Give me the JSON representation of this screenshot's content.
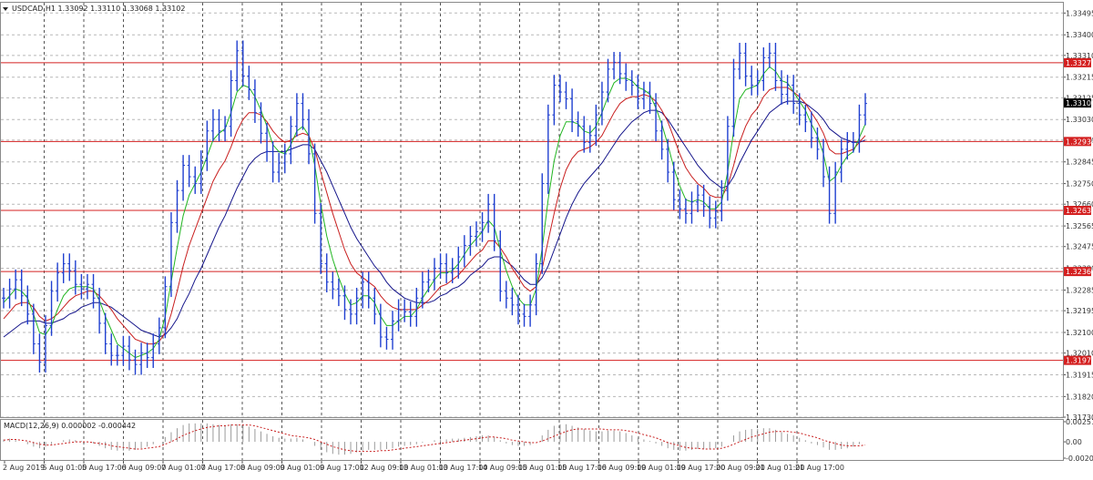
{
  "chart_data": {
    "type": "line",
    "symbol": "USDCAD,H1",
    "ohlc_header": "USDCAD,H1  1.33092 1.33110 1.33068 1.33102",
    "ylim": [
      1.3173,
      1.3354
    ],
    "price_ticks": [
      "1.33495",
      "1.33400",
      "1.33310",
      "1.33215",
      "1.33125",
      "1.33030",
      "1.32940",
      "1.32845",
      "1.32750",
      "1.32660",
      "1.32565",
      "1.32475",
      "1.32380",
      "1.32285",
      "1.32195",
      "1.32100",
      "1.32010",
      "1.31915",
      "1.31820",
      "1.31730"
    ],
    "time_labels": [
      "2 Aug 2019",
      "5 Aug 01:00",
      "5 Aug 17:00",
      "6 Aug 09:00",
      "7 Aug 01:00",
      "7 Aug 17:00",
      "8 Aug 09:00",
      "9 Aug 01:00",
      "9 Aug 17:00",
      "12 Aug 09:00",
      "13 Aug 01:00",
      "13 Aug 17:00",
      "14 Aug 09:00",
      "15 Aug 01:00",
      "15 Aug 17:00",
      "16 Aug 09:00",
      "19 Aug 01:00",
      "19 Aug 17:00",
      "20 Aug 09:00",
      "21 Aug 01:00",
      "21 Aug 17:00"
    ],
    "horizontal_levels": [
      {
        "label": "1.33278",
        "value": 1.33278
      },
      {
        "label": "1.32934",
        "value": 1.32934
      },
      {
        "label": "1.32633",
        "value": 1.32633
      },
      {
        "label": "1.32366",
        "value": 1.32366
      },
      {
        "label": "1.31978",
        "value": 1.31978
      }
    ],
    "current_price": "1.33102",
    "price_bars": [
      1.3225,
      1.3229,
      1.3233,
      1.3226,
      1.3218,
      1.3205,
      1.3197,
      1.3213,
      1.3228,
      1.3236,
      1.324,
      1.3237,
      1.3231,
      1.3229,
      1.3231,
      1.3225,
      1.3214,
      1.3205,
      1.32,
      1.32,
      1.3204,
      1.3198,
      1.3196,
      1.3201,
      1.3199,
      1.3205,
      1.3212,
      1.323,
      1.3258,
      1.3272,
      1.3283,
      1.3278,
      1.3275,
      1.3285,
      1.3298,
      1.3303,
      1.3298,
      1.33,
      1.332,
      1.3333,
      1.3322,
      1.3316,
      1.3306,
      1.3297,
      1.3289,
      1.328,
      1.3284,
      1.3288,
      1.33,
      1.331,
      1.3303,
      1.3288,
      1.3262,
      1.324,
      1.3232,
      1.3229,
      1.3226,
      1.322,
      1.3218,
      1.3225,
      1.3232,
      1.3225,
      1.3218,
      1.3208,
      1.3207,
      1.3215,
      1.322,
      1.3219,
      1.3217,
      1.3225,
      1.3232,
      1.3233,
      1.3238,
      1.324,
      1.3236,
      1.3238,
      1.3243,
      1.3248,
      1.3252,
      1.3254,
      1.3258,
      1.3266,
      1.325,
      1.3228,
      1.3225,
      1.3222,
      1.3218,
      1.3217,
      1.3222,
      1.324,
      1.3275,
      1.3305,
      1.3318,
      1.3315,
      1.3312,
      1.3302,
      1.33,
      1.3293,
      1.3296,
      1.3305,
      1.3315,
      1.3325,
      1.3328,
      1.3323,
      1.332,
      1.3318,
      1.3312,
      1.3315,
      1.331,
      1.3298,
      1.329,
      1.328,
      1.3268,
      1.3264,
      1.3262,
      1.3267,
      1.327,
      1.3265,
      1.326,
      1.3263,
      1.3272,
      1.33,
      1.3325,
      1.3332,
      1.3322,
      1.3318,
      1.332,
      1.333,
      1.3332,
      1.332,
      1.3314,
      1.3318,
      1.331,
      1.3305,
      1.3302,
      1.3295,
      1.329,
      1.3278,
      1.3262,
      1.328,
      1.329,
      1.3293,
      1.3293,
      1.3305,
      1.331
    ],
    "ma_fast": [
      1.3223,
      1.3226,
      1.3229,
      1.3228,
      1.3225,
      1.3218,
      1.321,
      1.3209,
      1.3213,
      1.322,
      1.3226,
      1.3229,
      1.323,
      1.323,
      1.323,
      1.3229,
      1.3224,
      1.3217,
      1.3211,
      1.3205,
      1.3203,
      1.3201,
      1.3199,
      1.32,
      1.3201,
      1.3203,
      1.3207,
      1.3217,
      1.3232,
      1.3247,
      1.3261,
      1.327,
      1.3275,
      1.328,
      1.3287,
      1.3294,
      1.3297,
      1.3299,
      1.3306,
      1.3315,
      1.3318,
      1.3317,
      1.3313,
      1.3307,
      1.33,
      1.3292,
      1.3289,
      1.3288,
      1.3292,
      1.3298,
      1.33,
      1.3296,
      1.3283,
      1.3266,
      1.3252,
      1.3242,
      1.3234,
      1.3227,
      1.3222,
      1.3223,
      1.3226,
      1.3226,
      1.3223,
      1.3217,
      1.3213,
      1.3213,
      1.3215,
      1.3217,
      1.3217,
      1.322,
      1.3225,
      1.3229,
      1.3233,
      1.3236,
      1.3236,
      1.3237,
      1.324,
      1.3244,
      1.3248,
      1.3251,
      1.3254,
      1.3259,
      1.3256,
      1.3246,
      1.3237,
      1.323,
      1.3225,
      1.3222,
      1.3222,
      1.3229,
      1.3247,
      1.3268,
      1.3285,
      1.3296,
      1.3302,
      1.3302,
      1.3301,
      1.3298,
      1.3297,
      1.33,
      1.3306,
      1.3313,
      1.3319,
      1.3321,
      1.3321,
      1.332,
      1.3317,
      1.3316,
      1.3314,
      1.3308,
      1.3301,
      1.3292,
      1.3282,
      1.3274,
      1.3268,
      1.3267,
      1.3268,
      1.3267,
      1.3264,
      1.3264,
      1.3267,
      1.328,
      1.3298,
      1.3312,
      1.3316,
      1.3317,
      1.3318,
      1.3323,
      1.3326,
      1.3324,
      1.332,
      1.3319,
      1.3315,
      1.3311,
      1.3307,
      1.3301,
      1.3296,
      1.3288,
      1.3276,
      1.3278,
      1.3283,
      1.3287,
      1.3289,
      1.3295,
      1.3301
    ],
    "ma_mid": [
      1.3216,
      1.3219,
      1.3222,
      1.3223,
      1.3223,
      1.3221,
      1.3217,
      1.3215,
      1.3216,
      1.3218,
      1.3221,
      1.3224,
      1.3226,
      1.3227,
      1.3228,
      1.3228,
      1.3226,
      1.3223,
      1.322,
      1.3216,
      1.3213,
      1.321,
      1.3207,
      1.3206,
      1.3205,
      1.3205,
      1.3206,
      1.321,
      1.3218,
      1.3228,
      1.3239,
      1.3248,
      1.3255,
      1.3262,
      1.3269,
      1.3276,
      1.3281,
      1.3285,
      1.3291,
      1.3298,
      1.3303,
      1.3306,
      1.3306,
      1.3305,
      1.3302,
      1.3298,
      1.3295,
      1.3293,
      1.3294,
      1.3296,
      1.3297,
      1.3296,
      1.329,
      1.328,
      1.3271,
      1.3262,
      1.3254,
      1.3246,
      1.324,
      1.3236,
      1.3234,
      1.3232,
      1.323,
      1.3226,
      1.3223,
      1.3221,
      1.322,
      1.322,
      1.322,
      1.322,
      1.3222,
      1.3224,
      1.3227,
      1.323,
      1.3231,
      1.3233,
      1.3235,
      1.3238,
      1.3241,
      1.3244,
      1.3246,
      1.325,
      1.325,
      1.3247,
      1.3243,
      1.3238,
      1.3234,
      1.323,
      1.3228,
      1.323,
      1.3238,
      1.325,
      1.3262,
      1.3273,
      1.3281,
      1.3286,
      1.3289,
      1.329,
      1.3291,
      1.3293,
      1.3296,
      1.3301,
      1.3306,
      1.331,
      1.3312,
      1.3313,
      1.3313,
      1.3314,
      1.3313,
      1.3311,
      1.3307,
      1.3302,
      1.3295,
      1.3288,
      1.3282,
      1.3278,
      1.3275,
      1.3273,
      1.327,
      1.3269,
      1.3269,
      1.3274,
      1.3283,
      1.3293,
      1.33,
      1.3305,
      1.3308,
      1.3313,
      1.3316,
      1.3317,
      1.3317,
      1.3317,
      1.3315,
      1.3313,
      1.331,
      1.3306,
      1.3302,
      1.3297,
      1.329,
      1.3288,
      1.3288,
      1.3289,
      1.329,
      1.3293,
      1.3296
    ],
    "ma_slow": [
      1.3208,
      1.321,
      1.3212,
      1.3214,
      1.3215,
      1.3215,
      1.3215,
      1.3214,
      1.3214,
      1.3215,
      1.3216,
      1.3218,
      1.3219,
      1.3221,
      1.3222,
      1.3223,
      1.3223,
      1.3222,
      1.3221,
      1.3219,
      1.3217,
      1.3215,
      1.3213,
      1.3211,
      1.321,
      1.3209,
      1.3208,
      1.3209,
      1.3212,
      1.3216,
      1.3222,
      1.3227,
      1.3233,
      1.3238,
      1.3244,
      1.325,
      1.3256,
      1.3261,
      1.3267,
      1.3273,
      1.3278,
      1.3283,
      1.3286,
      1.3288,
      1.3289,
      1.3289,
      1.3289,
      1.3289,
      1.329,
      1.3291,
      1.3292,
      1.3292,
      1.329,
      1.3285,
      1.328,
      1.3274,
      1.3268,
      1.3262,
      1.3256,
      1.3251,
      1.3247,
      1.3243,
      1.3239,
      1.3236,
      1.3232,
      1.3229,
      1.3227,
      1.3225,
      1.3224,
      1.3223,
      1.3223,
      1.3223,
      1.3224,
      1.3226,
      1.3227,
      1.3229,
      1.323,
      1.3232,
      1.3235,
      1.3237,
      1.3239,
      1.3242,
      1.3243,
      1.3243,
      1.3241,
      1.3239,
      1.3236,
      1.3233,
      1.3231,
      1.3231,
      1.3234,
      1.3239,
      1.3246,
      1.3253,
      1.326,
      1.3266,
      1.3271,
      1.3275,
      1.3278,
      1.3281,
      1.3284,
      1.3288,
      1.3292,
      1.3296,
      1.3299,
      1.3302,
      1.3304,
      1.3306,
      1.3307,
      1.3307,
      1.3306,
      1.3303,
      1.3299,
      1.3295,
      1.3291,
      1.3287,
      1.3283,
      1.328,
      1.3277,
      1.3275,
      1.3273,
      1.3274,
      1.3278,
      1.3284,
      1.3289,
      1.3294,
      1.3298,
      1.3302,
      1.3306,
      1.3308,
      1.331,
      1.3311,
      1.3311,
      1.3311,
      1.331,
      1.3308,
      1.3306,
      1.3303,
      1.3299,
      1.3297,
      1.3295,
      1.3294,
      1.3293,
      1.3293,
      1.3294
    ],
    "macd": {
      "label": "MACD(12,26,9) 0.000002 -0.000442",
      "ylim": [
        -0.002036,
        0.002513
      ],
      "ticks": [
        "0.002513",
        "0.00",
        "-0.002036"
      ],
      "histogram": [
        0.0003,
        0.0004,
        0.0002,
        0.0,
        -0.0003,
        -0.0006,
        -0.0008,
        -0.0006,
        -0.0003,
        0.0,
        0.0002,
        0.0003,
        0.0002,
        0.0001,
        0.0,
        -0.0002,
        -0.0005,
        -0.0008,
        -0.001,
        -0.0011,
        -0.0011,
        -0.0011,
        -0.001,
        -0.0008,
        -0.0006,
        -0.0003,
        0.0,
        0.0006,
        0.0012,
        0.0017,
        0.0021,
        0.0023,
        0.0023,
        0.0023,
        0.0023,
        0.0022,
        0.0021,
        0.0021,
        0.0022,
        0.0022,
        0.0021,
        0.0019,
        0.0016,
        0.0013,
        0.001,
        0.0007,
        0.0005,
        0.0004,
        0.0004,
        0.0005,
        0.0003,
        0.0,
        -0.0005,
        -0.001,
        -0.0013,
        -0.0015,
        -0.0016,
        -0.0016,
        -0.0015,
        -0.0013,
        -0.0011,
        -0.001,
        -0.001,
        -0.001,
        -0.0009,
        -0.0008,
        -0.0006,
        -0.0005,
        -0.0004,
        -0.0003,
        -0.0001,
        0.0,
        0.0002,
        0.0003,
        0.0003,
        0.0004,
        0.0004,
        0.0005,
        0.0006,
        0.0007,
        0.0008,
        0.0008,
        0.0006,
        0.0002,
        -0.0002,
        -0.0004,
        -0.0005,
        -0.0005,
        -0.0004,
        0.0,
        0.0008,
        0.0015,
        0.002,
        0.0022,
        0.0022,
        0.002,
        0.0018,
        0.0016,
        0.0014,
        0.0013,
        0.0013,
        0.0014,
        0.0014,
        0.0013,
        0.0011,
        0.0008,
        0.0005,
        0.0003,
        0.0001,
        -0.0002,
        -0.0005,
        -0.0008,
        -0.001,
        -0.0011,
        -0.0011,
        -0.001,
        -0.0009,
        -0.0009,
        -0.0009,
        -0.0008,
        -0.0006,
        0.0,
        0.0008,
        0.0013,
        0.0015,
        0.0016,
        0.0016,
        0.0017,
        0.0017,
        0.0015,
        0.0012,
        0.001,
        0.0008,
        0.0005,
        0.0002,
        -0.0002,
        -0.0004,
        -0.0007,
        -0.001,
        -0.001,
        -0.0009,
        -0.0008,
        -0.0006,
        -0.0003,
        0.0
      ],
      "signal": [
        0.0002,
        0.0003,
        0.0003,
        0.0002,
        0.0001,
        -0.0001,
        -0.0003,
        -0.0004,
        -0.0004,
        -0.0003,
        -0.0002,
        -0.0001,
        0.0,
        0.0,
        0.0,
        -0.0001,
        -0.0002,
        -0.0003,
        -0.0005,
        -0.0006,
        -0.0007,
        -0.0008,
        -0.0009,
        -0.0009,
        -0.0008,
        -0.0007,
        -0.0006,
        -0.0003,
        0.0,
        0.0004,
        0.0008,
        0.0011,
        0.0014,
        0.0016,
        0.0018,
        0.0019,
        0.002,
        0.002,
        0.0021,
        0.0021,
        0.0021,
        0.0021,
        0.002,
        0.0018,
        0.0016,
        0.0014,
        0.0012,
        0.001,
        0.0008,
        0.0007,
        0.0006,
        0.0005,
        0.0003,
        0.0,
        -0.0003,
        -0.0006,
        -0.0008,
        -0.001,
        -0.0011,
        -0.0012,
        -0.0012,
        -0.0012,
        -0.0012,
        -0.0011,
        -0.0011,
        -0.001,
        -0.0009,
        -0.0008,
        -0.0007,
        -0.0006,
        -0.0005,
        -0.0004,
        -0.0003,
        -0.0002,
        -0.0001,
        0.0,
        0.0001,
        0.0002,
        0.0003,
        0.0004,
        0.0005,
        0.0006,
        0.0006,
        0.0005,
        0.0004,
        0.0002,
        0.0001,
        0.0,
        -0.0001,
        -0.0001,
        0.0001,
        0.0004,
        0.0007,
        0.001,
        0.0013,
        0.0015,
        0.0016,
        0.0016,
        0.0016,
        0.0016,
        0.0016,
        0.0015,
        0.0015,
        0.0015,
        0.0014,
        0.0013,
        0.0011,
        0.0009,
        0.0007,
        0.0005,
        0.0002,
        -0.0001,
        -0.0003,
        -0.0005,
        -0.0007,
        -0.0008,
        -0.0008,
        -0.0009,
        -0.0009,
        -0.0009,
        -0.0008,
        -0.0006,
        -0.0003,
        0.0,
        0.0003,
        0.0006,
        0.0008,
        0.001,
        0.0012,
        0.0013,
        0.0013,
        0.0013,
        0.0012,
        0.0011,
        0.0009,
        0.0007,
        0.0005,
        0.0002,
        0.0,
        -0.0002,
        -0.0004,
        -0.0005,
        -0.0005,
        -0.0005,
        -0.0004
      ]
    }
  },
  "colors": {
    "price": "#1f3fd0",
    "ma_fast": "#22b622",
    "ma_mid": "#c81e1e",
    "ma_slow": "#14148a",
    "level_line": "#d42020",
    "level_tag": "#d42020",
    "current_tag": "#000000",
    "macd_hist": "#9a9a9a",
    "macd_signal": "#c81e1e"
  }
}
